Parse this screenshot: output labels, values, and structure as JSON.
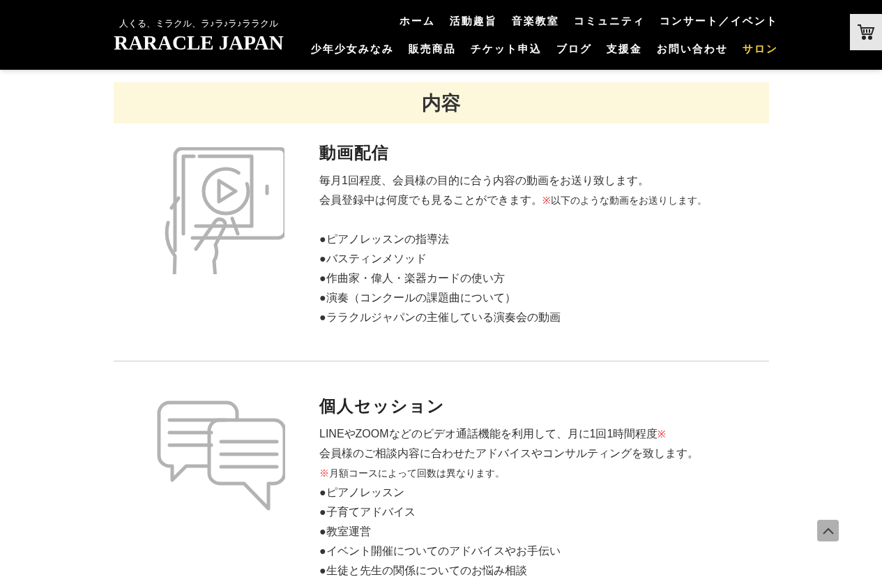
{
  "header": {
    "tagline": "人くる、ミラクル、ラ♪ラ♪ラ♪ララクル",
    "logo": "RARACLE JAPAN",
    "nav_rows": [
      [
        {
          "label": "ホーム",
          "selected": false
        },
        {
          "label": "活動趣旨",
          "selected": false
        },
        {
          "label": "音楽教室",
          "selected": false
        },
        {
          "label": "コミュニティ",
          "selected": false
        },
        {
          "label": "コンサート／イベント",
          "selected": false
        }
      ],
      [
        {
          "label": "少年少女みなみ",
          "selected": false
        },
        {
          "label": "販売商品",
          "selected": false
        },
        {
          "label": "チケット申込",
          "selected": false
        },
        {
          "label": "ブログ",
          "selected": false
        },
        {
          "label": "支援金",
          "selected": false
        },
        {
          "label": "お問い合わせ",
          "selected": false
        },
        {
          "label": "サロン",
          "selected": true
        }
      ]
    ]
  },
  "section_title": "内容",
  "sections": [
    {
      "kind": "video",
      "heading": "動画配信",
      "lines": [
        [
          {
            "kind": "text",
            "text": "毎月1回程度、会員様の目的に合う内容の動画をお送り致します。"
          }
        ],
        [
          {
            "kind": "text",
            "text": "会員登録中は何度でも見ることができます。"
          },
          {
            "kind": "mark",
            "text": "※"
          },
          {
            "kind": "note",
            "text": "以下のような動画をお送りします。"
          }
        ],
        [
          {
            "kind": "gap"
          },
          {
            "kind": "text",
            "text": "●ピアノレッスンの指導法"
          }
        ],
        [
          {
            "kind": "text",
            "text": "●バスティンメソッド"
          }
        ],
        [
          {
            "kind": "text",
            "text": "●作曲家・偉人・楽器カードの使い方"
          }
        ],
        [
          {
            "kind": "text",
            "text": "●演奏（コンクールの課題曲について）"
          }
        ],
        [
          {
            "kind": "text",
            "text": "●ララクルジャパンの主催している演奏会の動画"
          }
        ]
      ]
    },
    {
      "kind": "chat",
      "heading": "個人セッション",
      "lines": [
        [
          {
            "kind": "text",
            "text": "LINEやZOOMなどのビデオ通話機能を利用して、月に1回1時間程度"
          },
          {
            "kind": "mark",
            "text": "※"
          }
        ],
        [
          {
            "kind": "text",
            "text": "会員様のご相談内容に合わせたアドバイスやコンサルティングを致します。"
          }
        ],
        [
          {
            "kind": "mark",
            "text": "※"
          },
          {
            "kind": "note",
            "text": "月額コースによって回数は異なります。"
          }
        ],
        [
          {
            "kind": "text",
            "text": "●ピアノレッスン"
          }
        ],
        [
          {
            "kind": "text",
            "text": "●子育てアドバイス"
          }
        ],
        [
          {
            "kind": "text",
            "text": "●教室運営"
          }
        ],
        [
          {
            "kind": "text",
            "text": "●イベント開催についてのアドバイスやお手伝い"
          }
        ],
        [
          {
            "kind": "text",
            "text": "●生徒と先生の関係についてのお悩み相談"
          }
        ]
      ]
    }
  ]
}
